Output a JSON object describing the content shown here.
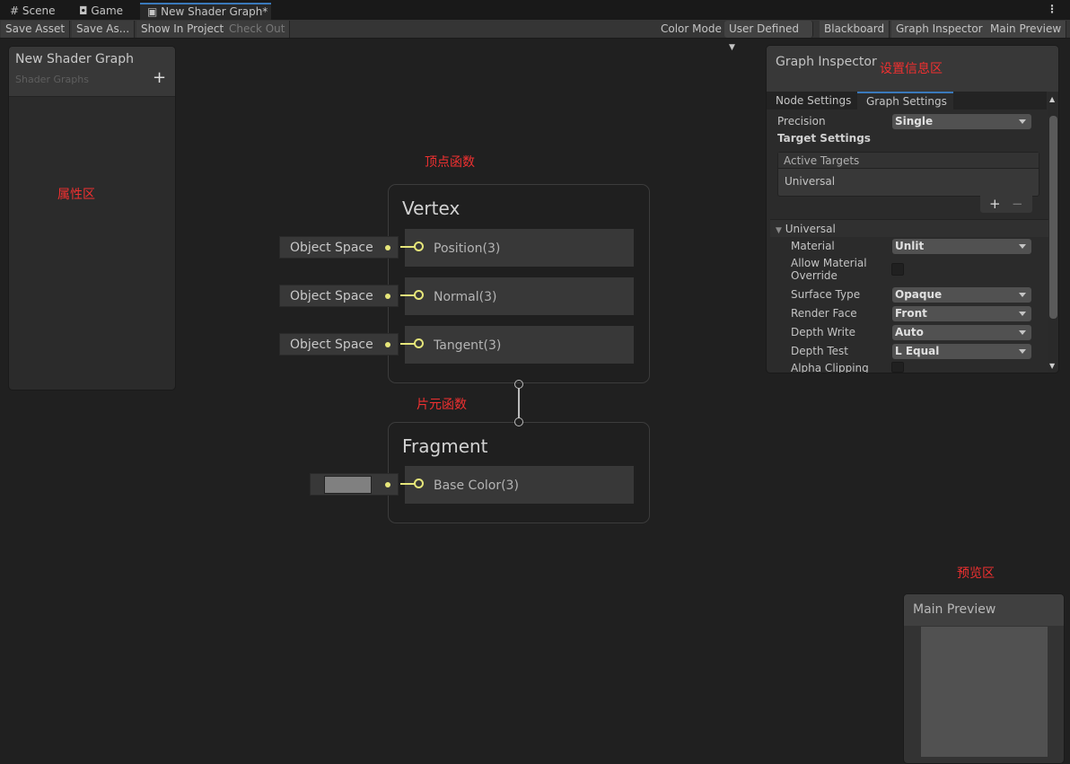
{
  "tabs": [
    {
      "label": "Scene",
      "icon": "grid-icon"
    },
    {
      "label": "Game",
      "icon": "gamepad-icon"
    },
    {
      "label": "New Shader Graph*",
      "icon": "shader-graph-icon",
      "active": true
    }
  ],
  "toolbar": {
    "save_asset": "Save Asset",
    "save_as": "Save As...",
    "show_in_project": "Show In Project",
    "check_out": "Check Out",
    "color_mode_label": "Color Mode",
    "color_mode_value": "User Defined",
    "blackboard": "Blackboard",
    "graph_inspector": "Graph Inspector",
    "main_preview": "Main Preview"
  },
  "blackboard": {
    "title": "New Shader Graph",
    "subtitle": "Shader Graphs",
    "add": "+"
  },
  "annotations": {
    "properties": "属性区",
    "vertex": "顶点函数",
    "fragment": "片元函数",
    "settings": "设置信息区",
    "preview": "预览区"
  },
  "vertex": {
    "title": "Vertex",
    "ports": [
      {
        "label": "Position(3)",
        "input": "Object Space"
      },
      {
        "label": "Normal(3)",
        "input": "Object Space"
      },
      {
        "label": "Tangent(3)",
        "input": "Object Space"
      }
    ]
  },
  "fragment": {
    "title": "Fragment",
    "ports": [
      {
        "label": "Base Color(3)",
        "swatch": "#808080"
      }
    ]
  },
  "inspector": {
    "title": "Graph Inspector",
    "tabs": [
      "Node Settings",
      "Graph Settings"
    ],
    "active_tab": "Graph Settings",
    "precision_label": "Precision",
    "precision": "Single",
    "target_settings": "Target Settings",
    "active_targets": "Active Targets",
    "target": "Universal",
    "plus": "+",
    "minus": "−",
    "section": "Universal",
    "fields": [
      {
        "label": "Material",
        "value": "Unlit"
      },
      {
        "label": "Allow Material Override",
        "checked": false
      },
      {
        "label": "Surface Type",
        "value": "Opaque"
      },
      {
        "label": "Render Face",
        "value": "Front"
      },
      {
        "label": "Depth Write",
        "value": "Auto"
      },
      {
        "label": "Depth Test",
        "value": "L Equal"
      },
      {
        "label": "Alpha Clipping",
        "checked": false
      }
    ]
  },
  "preview": {
    "title": "Main Preview"
  },
  "colors": {
    "accent": "#3a79bb",
    "port": "#e6e67a",
    "annotation": "#f03030"
  }
}
